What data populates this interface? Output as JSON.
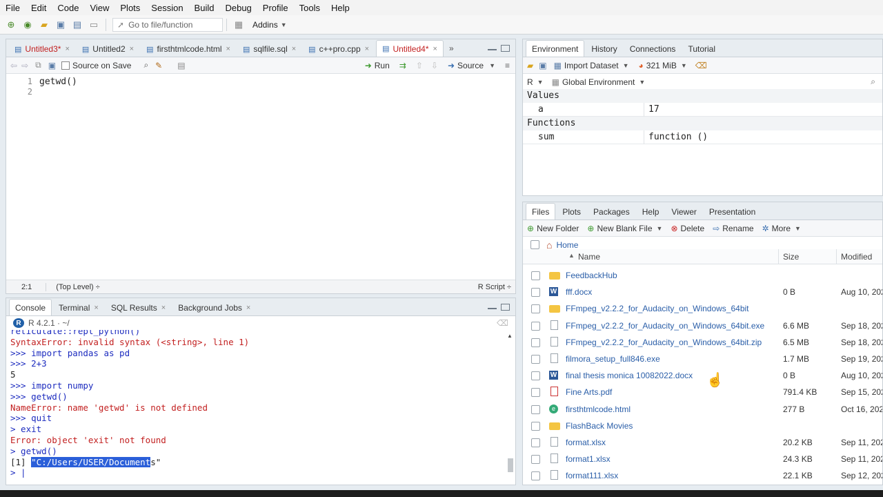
{
  "menu": [
    "File",
    "Edit",
    "Code",
    "View",
    "Plots",
    "Session",
    "Build",
    "Debug",
    "Profile",
    "Tools",
    "Help"
  ],
  "toolbar": {
    "goto_placeholder": "Go to file/function",
    "addins": "Addins"
  },
  "editor": {
    "tabs": [
      {
        "label": "Untitled3*",
        "modified": true
      },
      {
        "label": "Untitled2",
        "modified": false
      },
      {
        "label": "firsthtmlcode.html",
        "modified": false
      },
      {
        "label": "sqlfile.sql",
        "modified": false
      },
      {
        "label": "c++pro.cpp",
        "modified": false
      },
      {
        "label": "Untitled4*",
        "modified": true,
        "active": true
      }
    ],
    "source_on_save": "Source on Save",
    "run": "Run",
    "source": "Source",
    "lines": [
      {
        "num": "1",
        "code": "getwd()"
      },
      {
        "num": "2",
        "code": ""
      }
    ],
    "status_pos": "2:1",
    "status_scope": "(Top Level) ÷",
    "status_type": "R Script ÷"
  },
  "console": {
    "tabs": [
      "Console",
      "Terminal",
      "SQL Results",
      "Background Jobs"
    ],
    "r_version": "R 4.2.1 · ~/",
    "lines": [
      {
        "text": "reticulate::repl_python()",
        "color": "blue"
      },
      {
        "text": "SyntaxError: invalid syntax (<string>, line 1)",
        "color": "red"
      },
      {
        "text": ">>> import pandas as pd",
        "color": "blue"
      },
      {
        "text": ">>> 2+3",
        "color": "blue"
      },
      {
        "text": "5",
        "color": "dark"
      },
      {
        "text": ">>> import numpy",
        "color": "blue"
      },
      {
        "text": ">>> getwd()",
        "color": "blue"
      },
      {
        "text": "NameError: name 'getwd' is not defined",
        "color": "red"
      },
      {
        "text": ">>> quit",
        "color": "blue"
      },
      {
        "text": "> exit",
        "color": "blue"
      },
      {
        "text": "Error: object 'exit' not found",
        "color": "red"
      },
      {
        "text": "> getwd()",
        "color": "blue"
      }
    ],
    "result_prefix": "[1] ",
    "result_selected": "\"C:/Users/USER/Document",
    "result_rest": "s\"",
    "prompt": "> |"
  },
  "environment": {
    "tabs": [
      "Environment",
      "History",
      "Connections",
      "Tutorial"
    ],
    "import_dataset": "Import Dataset",
    "memory": "321 MiB",
    "lang": "R",
    "scope": "Global Environment",
    "sections": [
      {
        "title": "Values",
        "rows": [
          {
            "name": "a",
            "value": "17"
          }
        ]
      },
      {
        "title": "Functions",
        "rows": [
          {
            "name": "sum",
            "value": "function ()"
          }
        ]
      }
    ]
  },
  "files": {
    "tabs": [
      "Files",
      "Plots",
      "Packages",
      "Help",
      "Viewer",
      "Presentation"
    ],
    "actions": {
      "new_folder": "New Folder",
      "new_blank_file": "New Blank File",
      "delete": "Delete",
      "rename": "Rename",
      "more": "More"
    },
    "home": "Home",
    "headers": {
      "name": "Name",
      "size": "Size",
      "modified": "Modified"
    },
    "rows": [
      {
        "name": "FeedbackHub",
        "size": "",
        "modified": "",
        "icon": "folder"
      },
      {
        "name": "fff.docx",
        "size": "0 B",
        "modified": "Aug 10, 202",
        "icon": "word"
      },
      {
        "name": "FFmpeg_v2.2.2_for_Audacity_on_Windows_64bit",
        "size": "",
        "modified": "",
        "icon": "folder"
      },
      {
        "name": "FFmpeg_v2.2.2_for_Audacity_on_Windows_64bit.exe",
        "size": "6.6 MB",
        "modified": "Sep 18, 202",
        "icon": "doc"
      },
      {
        "name": "FFmpeg_v2.2.2_for_Audacity_on_Windows_64bit.zip",
        "size": "6.5 MB",
        "modified": "Sep 18, 202",
        "icon": "doc"
      },
      {
        "name": "filmora_setup_full846.exe",
        "size": "1.7 MB",
        "modified": "Sep 19, 202",
        "icon": "doc"
      },
      {
        "name": "final thesis monica 10082022.docx",
        "size": "0 B",
        "modified": "Aug 10, 202",
        "icon": "word"
      },
      {
        "name": "Fine Arts.pdf",
        "size": "791.4 KB",
        "modified": "Sep 15, 202",
        "icon": "pdf"
      },
      {
        "name": "firsthtmlcode.html",
        "size": "277 B",
        "modified": "Oct 16, 202",
        "icon": "html"
      },
      {
        "name": "FlashBack Movies",
        "size": "",
        "modified": "",
        "icon": "folder"
      },
      {
        "name": "format.xlsx",
        "size": "20.2 KB",
        "modified": "Sep 11, 202",
        "icon": "doc"
      },
      {
        "name": "format1.xlsx",
        "size": "24.3 KB",
        "modified": "Sep 11, 202",
        "icon": "doc"
      },
      {
        "name": "format111.xlsx",
        "size": "22.1 KB",
        "modified": "Sep 12, 202",
        "icon": "doc"
      }
    ]
  }
}
